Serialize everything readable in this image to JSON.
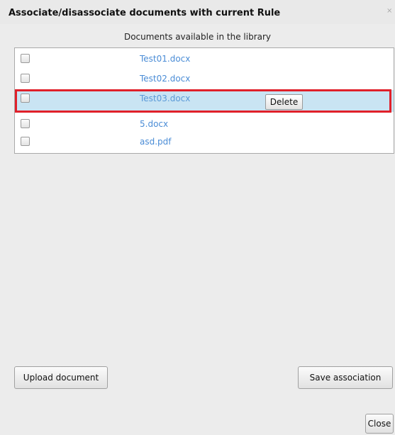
{
  "dialog": {
    "title": "Associate/disassociate documents with current Rule",
    "close_icon": "close-icon"
  },
  "library": {
    "caption": "Documents available in the library",
    "documents": [
      {
        "name": "Test01.docx",
        "checked": false
      },
      {
        "name": "Test02.docx",
        "checked": false
      },
      {
        "name": "Test03.docx",
        "checked": false,
        "selected": true
      },
      {
        "name": "5.docx",
        "checked": false
      },
      {
        "name": "asd.pdf",
        "checked": false
      }
    ],
    "row_action_label": "Delete"
  },
  "footer": {
    "upload_label": "Upload document",
    "save_label": "Save association",
    "close_label": "Close"
  },
  "colors": {
    "link": "#4a8cd6",
    "selected_row": "#c9e4f3",
    "highlight_border": "#e0202a"
  }
}
